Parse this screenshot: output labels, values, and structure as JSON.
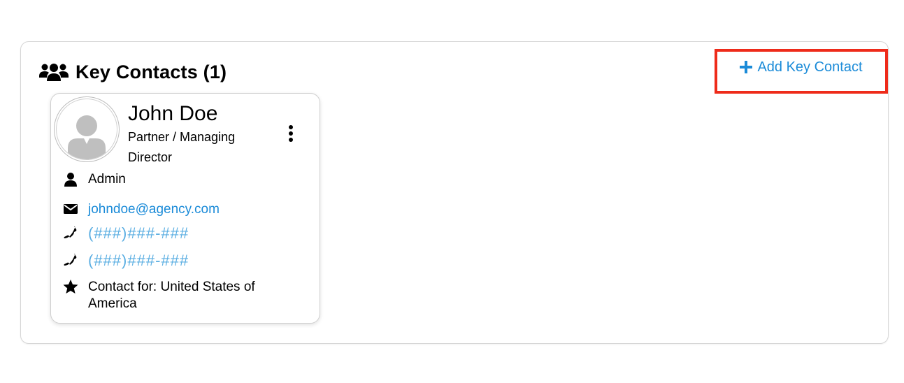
{
  "panel": {
    "title": "Key Contacts (1)",
    "add_button_label": "Add Key Contact"
  },
  "contact": {
    "name": "John Doe",
    "title": "Partner / Managing Director",
    "role": "Admin",
    "email": "johndoe@agency.com",
    "phones": [
      "(###)###-###",
      "(###)###-###"
    ],
    "contact_for": "Contact for: United States of America"
  },
  "colors": {
    "link": "#1b8bd8",
    "phone": "#5aaee2",
    "highlight": "#ee2b1a"
  },
  "icons": {
    "header": "users-icon",
    "add": "plus-icon",
    "role": "user-icon",
    "email": "envelope-icon",
    "phone": "phone-icon",
    "contact_for": "star-icon",
    "menu": "kebab-menu-icon"
  }
}
